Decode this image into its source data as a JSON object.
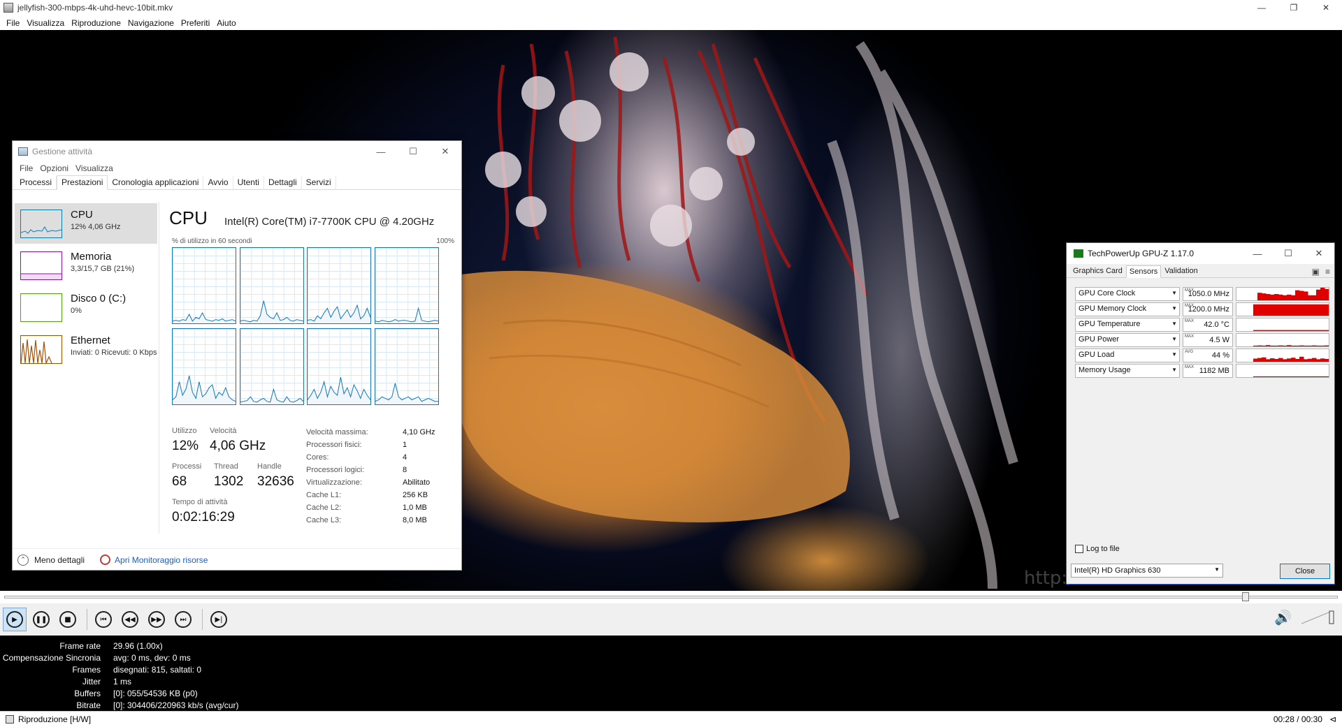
{
  "player": {
    "title": "jellyfish-300-mbps-4k-uhd-hevc-10bit.mkv",
    "window_buttons": [
      "—",
      "❐",
      "✕"
    ],
    "menu": [
      "File",
      "Visualizza",
      "Riproduzione",
      "Navigazione",
      "Preferiti",
      "Aiuto"
    ],
    "watermark": "http:/",
    "seek_progress": 0.933,
    "stats": [
      {
        "k": "Frame rate",
        "v": "29.96 (1.00x)"
      },
      {
        "k": "Compensazione Sincronia",
        "v": "avg: 0 ms, dev: 0 ms"
      },
      {
        "k": "Frames",
        "v": "disegnati: 815, saltati: 0"
      },
      {
        "k": "Jitter",
        "v": "1 ms"
      },
      {
        "k": "Buffers",
        "v": "[0]: 055/54536 KB (p0)"
      },
      {
        "k": "Bitrate",
        "v": "[0]: 304406/220963 kb/s (avg/cur)"
      }
    ],
    "status": "Riproduzione [H/W]",
    "time": "00:28 / 00:30",
    "status_icon": "⊲"
  },
  "taskmgr": {
    "title": "Gestione attività",
    "window_buttons": [
      "—",
      "☐",
      "✕"
    ],
    "menu": [
      "File",
      "Opzioni",
      "Visualizza"
    ],
    "tabs": [
      "Processi",
      "Prestazioni",
      "Cronologia applicazioni",
      "Avvio",
      "Utenti",
      "Dettagli",
      "Servizi"
    ],
    "selected_tab": 1,
    "sidebar": [
      {
        "name": "CPU",
        "sub": "12% 4,06 GHz",
        "color": "#1177bb",
        "selected": true
      },
      {
        "name": "Memoria",
        "sub": "3,3/15,7 GB (21%)",
        "color": "#8b12ae",
        "selected": false
      },
      {
        "name": "Disco 0 (C:)",
        "sub": "0%",
        "color": "#4da60c",
        "selected": false
      },
      {
        "name": "Ethernet",
        "sub": "Inviati: 0 Ricevuti: 0 Kbps",
        "color": "#a74f01",
        "selected": false
      }
    ],
    "cpu": {
      "header": "CPU",
      "name": "Intel(R) Core(TM) i7-7700K CPU @ 4.20GHz",
      "util_label": "% di utilizzo in 60 secondi",
      "pct_label": "100%",
      "cores_series": [
        [
          3,
          4,
          3,
          5,
          4,
          12,
          3,
          8,
          6,
          14,
          5,
          4,
          3,
          5,
          4,
          6,
          3,
          4,
          5,
          3
        ],
        [
          3,
          4,
          3,
          2,
          4,
          3,
          10,
          30,
          12,
          8,
          6,
          14,
          4,
          5,
          8,
          4,
          3,
          5,
          4,
          3
        ],
        [
          4,
          5,
          3,
          10,
          6,
          14,
          20,
          8,
          16,
          22,
          6,
          12,
          18,
          8,
          14,
          24,
          6,
          10,
          20,
          8
        ],
        [
          3,
          2,
          4,
          3,
          2,
          3,
          5,
          3,
          4,
          4,
          3,
          2,
          3,
          20,
          4,
          3,
          2,
          3,
          4,
          3
        ],
        [
          6,
          10,
          30,
          12,
          20,
          38,
          16,
          8,
          30,
          10,
          14,
          22,
          26,
          8,
          16,
          12,
          22,
          10,
          6,
          4
        ],
        [
          3,
          4,
          5,
          10,
          4,
          3,
          6,
          8,
          4,
          3,
          20,
          6,
          4,
          3,
          10,
          4,
          3,
          5,
          8,
          4
        ],
        [
          6,
          12,
          20,
          8,
          16,
          30,
          10,
          24,
          16,
          12,
          36,
          14,
          22,
          10,
          26,
          18,
          8,
          20,
          12,
          6
        ],
        [
          4,
          6,
          10,
          8,
          6,
          10,
          28,
          10,
          6,
          8,
          10,
          6,
          8,
          10,
          4,
          6,
          8,
          6,
          4,
          4
        ]
      ],
      "stats": [
        {
          "label": "Utilizzo",
          "value": "12%"
        },
        {
          "label": "Velocità",
          "value": "4,06 GHz"
        },
        {
          "label": "Processi",
          "value": "68"
        },
        {
          "label": "Thread",
          "value": "1302"
        },
        {
          "label": "Handle",
          "value": "32636"
        },
        {
          "label": "Tempo di attività",
          "value": "0:02:16:29"
        }
      ],
      "details": [
        {
          "k": "Velocità massima:",
          "v": "4,10 GHz"
        },
        {
          "k": "Processori fisici:",
          "v": "1"
        },
        {
          "k": "Cores:",
          "v": "4"
        },
        {
          "k": "Processori logici:",
          "v": "8"
        },
        {
          "k": "Virtualizzazione:",
          "v": "Abilitato"
        },
        {
          "k": "Cache L1:",
          "v": "256 KB"
        },
        {
          "k": "Cache L2:",
          "v": "1,0 MB"
        },
        {
          "k": "Cache L3:",
          "v": "8,0 MB"
        }
      ]
    },
    "footer": {
      "less": "Meno dettagli",
      "monitor": "Apri Monitoraggio risorse"
    }
  },
  "gpuz": {
    "title": "TechPowerUp GPU-Z 1.17.0",
    "window_buttons": [
      "—",
      "☐",
      "✕"
    ],
    "tabs": [
      "Graphics Card",
      "Sensors",
      "Validation"
    ],
    "selected_tab": 1,
    "tool_icons": [
      "camera-icon",
      "menu-icon"
    ],
    "sensors": [
      {
        "name": "GPU Core Clock",
        "tag": "MAX",
        "value": "1050.0 MHz",
        "level": [
          0,
          0,
          0,
          0,
          0,
          60,
          55,
          50,
          45,
          50,
          45,
          40,
          45,
          40,
          80,
          75,
          70,
          40,
          40,
          85,
          100,
          90
        ]
      },
      {
        "name": "GPU Memory Clock",
        "tag": "MAX",
        "value": "1200.0 MHz",
        "level": [
          0,
          0,
          0,
          0,
          90,
          90,
          90,
          90,
          90,
          90,
          90,
          90,
          90,
          90,
          90,
          90,
          90,
          90,
          90,
          90,
          90,
          90
        ]
      },
      {
        "name": "GPU Temperature",
        "tag": "MAX",
        "value": "42.0 °C",
        "level": [
          0,
          0,
          0,
          0,
          8,
          8,
          8,
          8,
          8,
          8,
          8,
          8,
          8,
          8,
          8,
          8,
          8,
          8,
          8,
          8,
          8,
          8
        ]
      },
      {
        "name": "GPU Power",
        "tag": "MAX",
        "value": "4.5 W",
        "level": [
          0,
          0,
          0,
          0,
          6,
          8,
          6,
          10,
          6,
          6,
          8,
          6,
          10,
          6,
          6,
          8,
          6,
          6,
          8,
          6,
          6,
          8
        ]
      },
      {
        "name": "GPU Load",
        "tag": "AVG",
        "value": "44 %",
        "level": [
          0,
          0,
          0,
          0,
          25,
          30,
          35,
          20,
          28,
          22,
          30,
          20,
          26,
          32,
          22,
          40,
          20,
          24,
          30,
          20,
          26,
          22
        ]
      },
      {
        "name": "Memory Usage",
        "tag": "MAX",
        "value": "1182 MB",
        "level": [
          0,
          0,
          0,
          0,
          6,
          6,
          6,
          6,
          6,
          6,
          6,
          6,
          6,
          6,
          6,
          6,
          6,
          6,
          6,
          6,
          6,
          6
        ]
      }
    ],
    "log_to_file": "Log to file",
    "gpu": "Intel(R) HD Graphics 630",
    "close": "Close"
  }
}
